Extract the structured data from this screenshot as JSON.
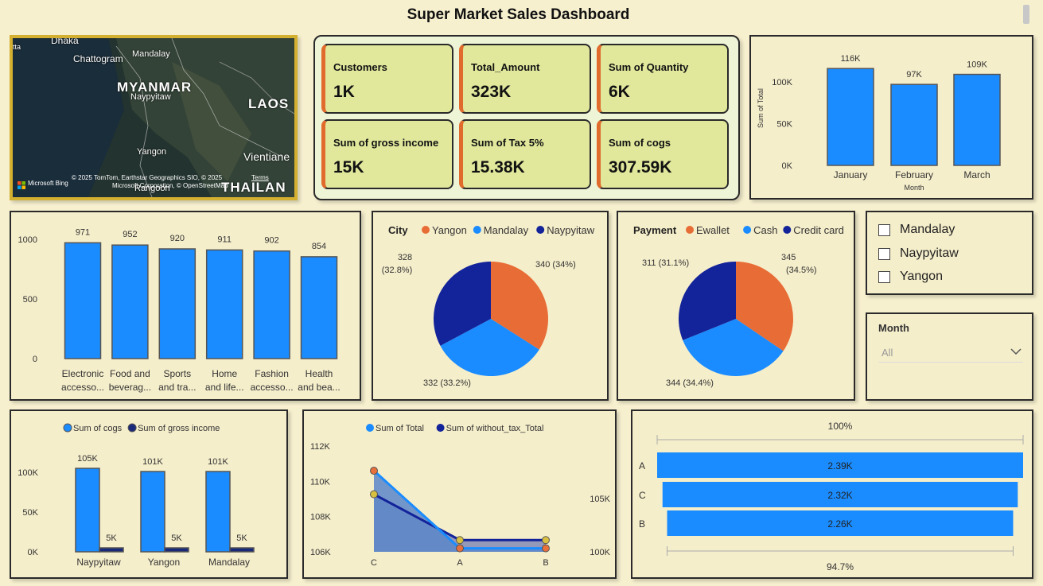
{
  "dashboard": {
    "title": "Super Market Sales Dashboard"
  },
  "map": {
    "labels": [
      "Dhaka",
      "Chattogram",
      "Mandalay",
      "MYANMAR",
      "Naypyitaw",
      "LAOS",
      "Yangon",
      "Vientiane",
      "Rangoon",
      "THAILAN",
      "tta"
    ],
    "brand": "Microsoft Bing",
    "attribution1": "© 2025 TomTom, Earthstar Geographics SIO, © 2025",
    "attribution_terms": "Terms",
    "attribution2": "Microsoft Corporation, © OpenStreetMap"
  },
  "cards": [
    {
      "label": "Customers",
      "value": "1K"
    },
    {
      "label": "Total_Amount",
      "value": "323K"
    },
    {
      "label": "Sum of Quantity",
      "value": "6K"
    },
    {
      "label": "Sum of gross income",
      "value": "15K"
    },
    {
      "label": "Sum of Tax 5%",
      "value": "15.38K"
    },
    {
      "label": "Sum of cogs",
      "value": "307.59K"
    }
  ],
  "slicer_city": {
    "items": [
      "Mandalay",
      "Naypyitaw",
      "Yangon"
    ]
  },
  "slicer_month": {
    "title": "Month",
    "value": "All"
  },
  "chart_data": [
    {
      "id": "month_bar",
      "type": "bar",
      "categories": [
        "January",
        "February",
        "March"
      ],
      "values": [
        116,
        97,
        109
      ],
      "data_labels": [
        "116K",
        "97K",
        "109K"
      ],
      "ylabel": "Sum of Total",
      "xlabel": "Month",
      "ylim": [
        0,
        120
      ],
      "yticks": [
        0,
        50,
        100
      ],
      "ytick_labels": [
        "0K",
        "50K",
        "100K"
      ],
      "color": "#1a8cff"
    },
    {
      "id": "product_bar",
      "type": "bar",
      "categories": [
        [
          "Electronic",
          "accesso..."
        ],
        [
          "Food and",
          "beverag..."
        ],
        [
          "Sports",
          "and tra..."
        ],
        [
          "Home",
          "and life..."
        ],
        [
          "Fashion",
          "accesso..."
        ],
        [
          "Health",
          "and bea..."
        ]
      ],
      "values": [
        971,
        952,
        920,
        911,
        902,
        854
      ],
      "data_labels": [
        "971",
        "952",
        "920",
        "911",
        "902",
        "854"
      ],
      "ylim": [
        0,
        1000
      ],
      "yticks": [
        0,
        500,
        1000
      ],
      "ytick_labels": [
        "0",
        "500",
        "1000"
      ],
      "color": "#1a8cff"
    },
    {
      "id": "city_pie",
      "type": "pie",
      "legend_title": "City",
      "slices": [
        {
          "name": "Yangon",
          "value": 340,
          "label": "340 (34%)",
          "color": "#e86c35"
        },
        {
          "name": "Mandalay",
          "value": 332,
          "label": "332 (33.2%)",
          "color": "#1a8cff"
        },
        {
          "name": "Naypyitaw",
          "value": 328,
          "label": "328",
          "label2": "(32.8%)",
          "color": "#13239a"
        }
      ]
    },
    {
      "id": "payment_pie",
      "type": "pie",
      "legend_title": "Payment",
      "slices": [
        {
          "name": "Ewallet",
          "value": 345,
          "label": "345",
          "label2": "(34.5%)",
          "color": "#e86c35"
        },
        {
          "name": "Cash",
          "value": 344,
          "label": "344 (34.4%)",
          "color": "#1a8cff"
        },
        {
          "name": "Credit card",
          "value": 311,
          "label": "311 (31.1%)",
          "color": "#13239a"
        }
      ]
    },
    {
      "id": "cogs_bar",
      "type": "bar",
      "categories": [
        "Naypyitaw",
        "Yangon",
        "Mandalay"
      ],
      "series": [
        {
          "name": "Sum of cogs",
          "values": [
            105,
            101,
            101
          ],
          "labels": [
            "105K",
            "101K",
            "101K"
          ],
          "color": "#1a8cff"
        },
        {
          "name": "Sum of gross income",
          "values": [
            5,
            5,
            5
          ],
          "labels": [
            "5K",
            "5K",
            "5K"
          ],
          "color": "#1a2a7a"
        }
      ],
      "ylim": [
        0,
        120
      ],
      "yticks": [
        0,
        50,
        100
      ],
      "ytick_labels": [
        "0K",
        "50K",
        "100K"
      ]
    },
    {
      "id": "area_chart",
      "type": "area",
      "categories": [
        "C",
        "A",
        "B"
      ],
      "series": [
        {
          "name": "Sum of Total",
          "values": [
            110.6,
            106.2,
            106.2
          ],
          "color": "#1a8cff",
          "axis": "left"
        },
        {
          "name": "Sum of without_tax_Total",
          "values": [
            105.4,
            101.1,
            101.1
          ],
          "color": "#13239a",
          "axis": "right"
        }
      ],
      "ylim_left": [
        106,
        112
      ],
      "yticks_left": [
        106,
        108,
        110,
        112
      ],
      "ytick_labels_left": [
        "106K",
        "108K",
        "110K",
        "112K"
      ],
      "ylim_right": [
        100,
        105
      ],
      "yticks_right": [
        100,
        105
      ],
      "ytick_labels_right": [
        "100K",
        "105K"
      ]
    },
    {
      "id": "funnel",
      "type": "bar",
      "categories": [
        "A",
        "C",
        "B"
      ],
      "values": [
        2.39,
        2.32,
        2.26
      ],
      "data_labels": [
        "2.39K",
        "2.32K",
        "2.26K"
      ],
      "top_label": "100%",
      "bottom_label": "94.7%",
      "color": "#1a8cff"
    }
  ]
}
